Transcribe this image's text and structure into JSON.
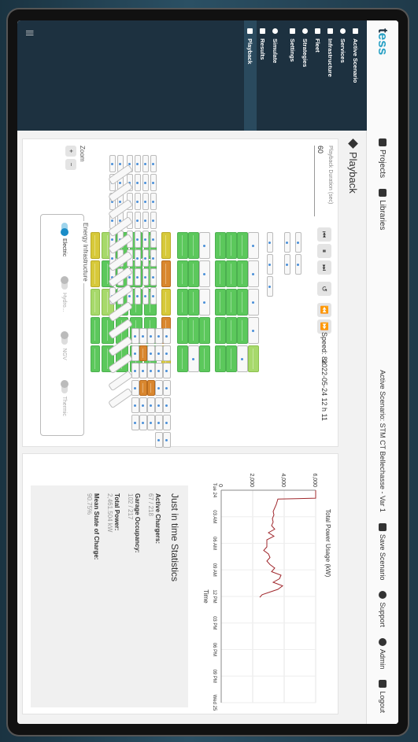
{
  "app": {
    "logo_main": "t",
    "logo_accent": "ess",
    "logo_rest": "SS",
    "logo_text": "tess"
  },
  "topbar": {
    "projects": "Projects",
    "libraries": "Libraries",
    "active_scenario": "Active Scenario: STM CT Bellechasse - Var 1",
    "save": "Save Scenario",
    "support": "Support",
    "admin": "Admin",
    "logout": "Logout"
  },
  "sidebar": {
    "items": [
      {
        "label": "Active Scenario",
        "icon": "tag-icon"
      },
      {
        "label": "Services",
        "icon": "services-icon"
      },
      {
        "label": "Infrastructure",
        "icon": "grid-icon"
      },
      {
        "label": "Fleet",
        "icon": "bus-icon"
      },
      {
        "label": "Strategies",
        "icon": "strategy-icon"
      },
      {
        "label": "Settings",
        "icon": "settings-icon"
      },
      {
        "label": "Simulate",
        "icon": "play-icon"
      },
      {
        "label": "Results",
        "icon": "results-icon"
      },
      {
        "label": "Playback",
        "icon": "playback-icon"
      }
    ],
    "collapse_glyph": "|||"
  },
  "playback": {
    "title": "Playback",
    "duration_label": "Playback Duration (sec)",
    "duration_value": "60",
    "speed": "Speed: 8x",
    "time": "2022-05-24 12 h 11",
    "zoom_label": "Zoom",
    "zoom_in": "+",
    "zoom_out": "−",
    "controls": [
      "⏮",
      "⏸",
      "⏭",
      "↺",
      "⏪",
      "⏩"
    ]
  },
  "infrastructure": {
    "legend": "Energy Infrastructure",
    "options": [
      {
        "label": "Electric",
        "on": true
      },
      {
        "label": "Hydro...",
        "on": false
      },
      {
        "label": "NGV",
        "on": false
      },
      {
        "label": "Thermic",
        "on": false
      }
    ]
  },
  "stats": {
    "heading": "Just in time Statistics",
    "items": [
      {
        "label": "Active Chargers:",
        "value": "67 / 218"
      },
      {
        "label": "Garage Occupancy:",
        "value": "102 / 217"
      },
      {
        "label": "Total Power:",
        "value": "2,461.504 kW"
      },
      {
        "label": "Mean State of Charge:",
        "value": "90.75%"
      }
    ]
  },
  "chart_data": {
    "type": "line",
    "title": "Total Power Usage (kW)",
    "xlabel": "Time",
    "ylabel": "",
    "x_ticks": [
      "Tue 24",
      "03 AM",
      "06 AM",
      "09 AM",
      "12 PM",
      "03 PM",
      "06 PM",
      "09 PM",
      "Wed 25"
    ],
    "y_ticks": [
      "0",
      "2,000",
      "4,000",
      "6,000"
    ],
    "ylim": [
      0,
      6000
    ],
    "xlim": [
      0,
      24
    ],
    "series": [
      {
        "color": "#a0282d",
        "x": [
          0,
          0.9,
          1.0,
          1.6,
          2.0,
          2.4,
          2.8,
          3.2,
          3.6,
          4.0,
          4.4,
          4.8,
          5.2,
          5.6,
          6.0,
          6.4,
          6.8,
          7.2,
          7.6,
          8.0,
          8.4,
          8.8,
          9.2,
          9.6,
          10.0,
          10.4,
          10.8,
          11.2,
          11.5,
          11.8,
          12.1
        ],
        "values": [
          6000,
          6000,
          3600,
          3500,
          3400,
          3300,
          3350,
          3250,
          3300,
          3200,
          3400,
          3000,
          3350,
          2900,
          2900,
          2900,
          2700,
          3000,
          3100,
          2900,
          3100,
          3400,
          3200,
          3800,
          3700,
          3300,
          3900,
          3600,
          3100,
          2600,
          2450
        ]
      }
    ]
  }
}
